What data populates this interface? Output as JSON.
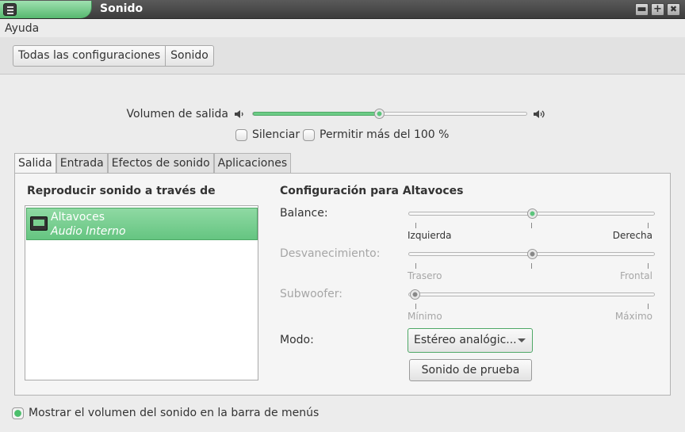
{
  "window": {
    "title": "Sonido",
    "minimize": "▬",
    "maximize": "+",
    "close": "✖"
  },
  "menubar": {
    "items": [
      "Ayuda"
    ]
  },
  "breadcrumb": [
    "Todas las configuraciones",
    "Sonido"
  ],
  "volume": {
    "label": "Volumen de salida",
    "level": 0.46,
    "mute_label": "Silenciar",
    "mute": false,
    "overamp_label": "Permitir más del 100 %",
    "overamp": false
  },
  "tabs": [
    "Salida",
    "Entrada",
    "Efectos de sonido",
    "Aplicaciones"
  ],
  "active_tab": "Salida",
  "output": {
    "list_heading": "Reproducir sonido a través de",
    "devices": [
      {
        "name": "Altavoces",
        "description": "Audio Interno",
        "selected": true
      }
    ],
    "settings_heading": "Configuración para Altavoces",
    "balance": {
      "label": "Balance:",
      "min_label": "Izquierda",
      "max_label": "Derecha",
      "value": 0.5
    },
    "fade": {
      "label": "Desvanecimiento:",
      "min_label": "Trasero",
      "max_label": "Frontal",
      "value": 0.5,
      "enabled": false
    },
    "subwoofer": {
      "label": "Subwoofer:",
      "min_label": "Mínimo",
      "max_label": "Máximo",
      "value": 0.0,
      "enabled": false
    },
    "mode": {
      "label": "Modo:",
      "value": "Estéreo analógic..."
    },
    "test_button": "Sonido de prueba"
  },
  "footer": {
    "show_in_menubar_label": "Mostrar el volumen del sonido en la barra de menús",
    "show_in_menubar": true
  },
  "colors": {
    "accent": "#65c581",
    "titlebar": "#4a4a4a"
  }
}
